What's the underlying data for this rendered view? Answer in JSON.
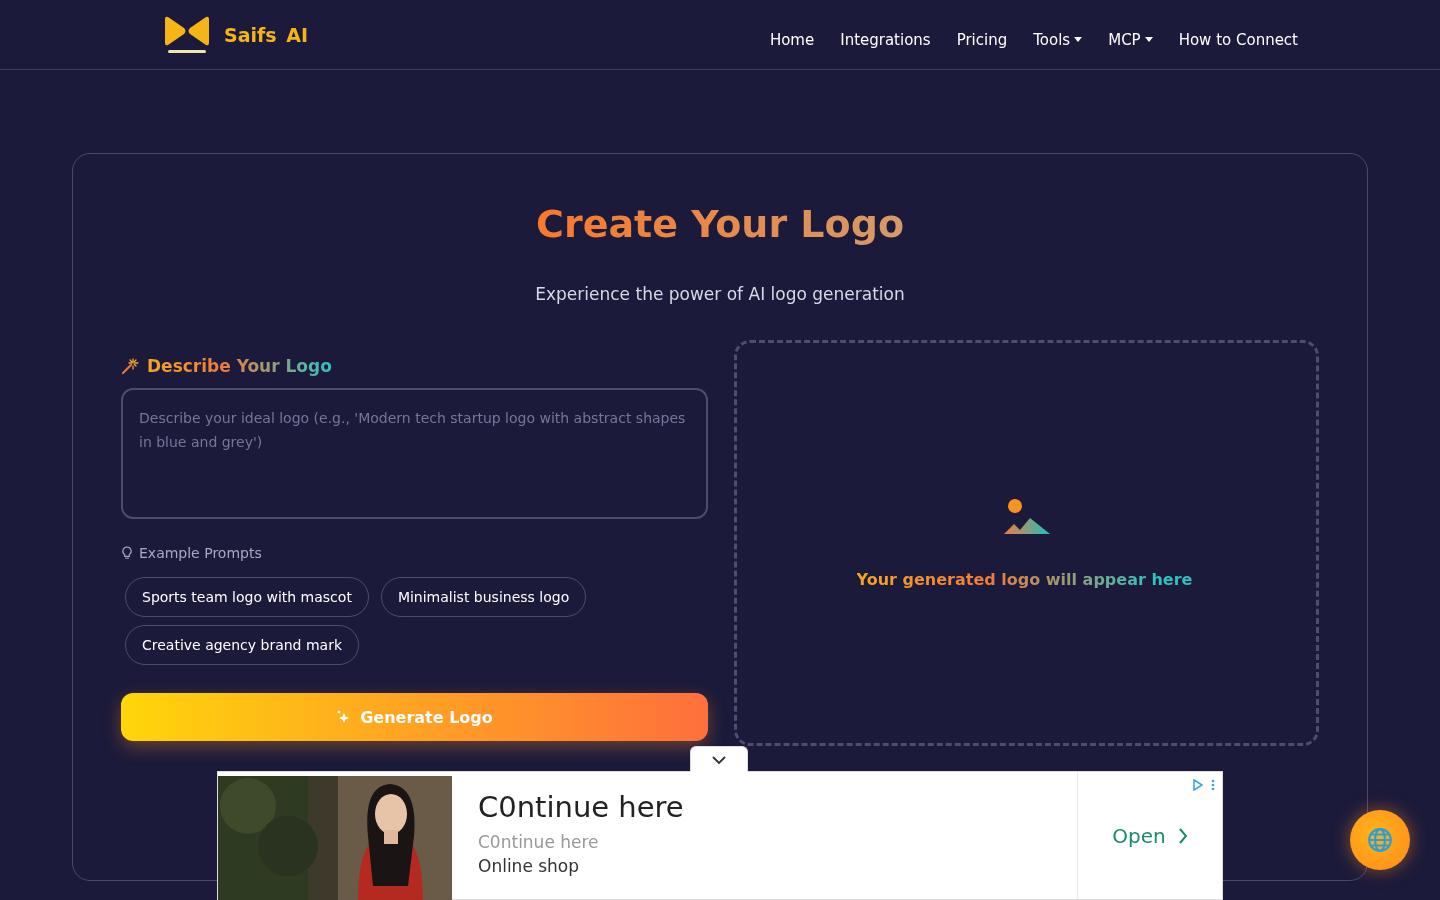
{
  "brand": {
    "name": "Saifs AI"
  },
  "nav": [
    {
      "label": "Home",
      "dropdown": false
    },
    {
      "label": "Integrations",
      "dropdown": false
    },
    {
      "label": "Pricing",
      "dropdown": false
    },
    {
      "label": "Tools",
      "dropdown": true
    },
    {
      "label": "MCP",
      "dropdown": true
    },
    {
      "label": "How to Connect",
      "dropdown": false
    }
  ],
  "hero": {
    "title": "Create Your Logo",
    "subtitle": "Experience the power of AI logo generation"
  },
  "form": {
    "label": "Describe Your Logo",
    "prompt_field": {
      "placeholder": "Describe your ideal logo (e.g., 'Modern tech startup logo with abstract shapes in blue and grey')"
    },
    "examples_label": "Example Prompts",
    "examples": [
      "Sports team logo with mascot",
      "Minimalist business logo",
      "Creative agency brand mark"
    ],
    "generate_button": "Generate Logo"
  },
  "preview": {
    "empty_text": "Your generated logo will appear here"
  },
  "ad": {
    "headline": "C0ntinue here",
    "subline": "C0ntinue here",
    "source": "Online shop",
    "action": "Open"
  }
}
